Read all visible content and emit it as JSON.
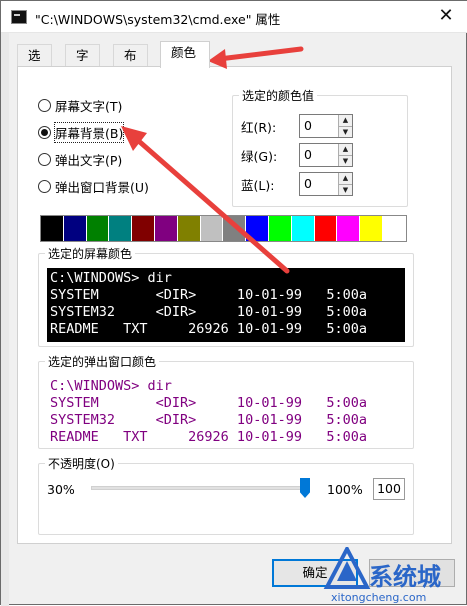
{
  "window": {
    "title": "\"C:\\WINDOWS\\system32\\cmd.exe\" 属性",
    "close_glyph": "✕"
  },
  "tabs": [
    {
      "label": "选项",
      "active": false
    },
    {
      "label": "字体",
      "active": false
    },
    {
      "label": "布局",
      "active": false
    },
    {
      "label": "颜色",
      "active": true
    }
  ],
  "radios": [
    {
      "label": "屏幕文字(T)",
      "checked": false
    },
    {
      "label": "屏幕背景(B)",
      "checked": true
    },
    {
      "label": "弹出文字(P)",
      "checked": false
    },
    {
      "label": "弹出窗口背景(U)",
      "checked": false
    }
  ],
  "color_values": {
    "title": "选定的颜色值",
    "red_label": "红(R):",
    "green_label": "绿(G):",
    "blue_label": "蓝(L):",
    "red": "0",
    "green": "0",
    "blue": "0"
  },
  "palette": [
    "#000000",
    "#000080",
    "#008000",
    "#008080",
    "#800000",
    "#800080",
    "#808000",
    "#c0c0c0",
    "#808080",
    "#0000ff",
    "#00ff00",
    "#00ffff",
    "#ff0000",
    "#ff00ff",
    "#ffff00",
    "#ffffff"
  ],
  "selected_palette_index": 0,
  "screen_preview": {
    "title": "选定的屏幕颜色",
    "background": "#000000",
    "color": "#ffffff",
    "lines": [
      "C:\\WINDOWS> dir",
      "SYSTEM       <DIR>     10-01-99   5:00a",
      "SYSTEM32     <DIR>     10-01-99   5:00a",
      "README   TXT     26926 10-01-99   5:00a"
    ]
  },
  "popup_preview": {
    "title": "选定的弹出窗口颜色",
    "background": "#ffffff",
    "color": "#800080",
    "lines": [
      "C:\\WINDOWS> dir",
      "SYSTEM       <DIR>     10-01-99   5:00a",
      "SYSTEM32     <DIR>     10-01-99   5:00a",
      "README   TXT     26926 10-01-99   5:00a"
    ]
  },
  "opacity": {
    "title": "不透明度(O)",
    "min_label": "30%",
    "max_label": "100%",
    "value": "100",
    "level": 1.0
  },
  "buttons": {
    "ok": "确定"
  },
  "watermark": {
    "text": "系统城",
    "url": "xitongcheng.com"
  },
  "colors": {
    "accent": "#0078d7",
    "annotation_arrow": "#e8403c"
  }
}
